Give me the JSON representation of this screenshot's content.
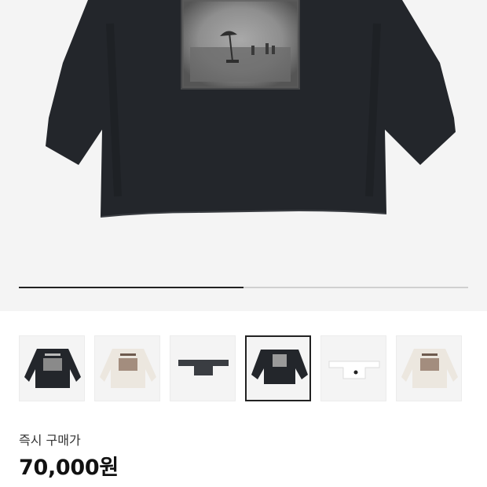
{
  "gallery": {
    "current_index": 1,
    "total": 2,
    "progress_fraction": 0.5,
    "selected_thumbnail": 3,
    "thumbnails": [
      {
        "name": "thumb-black-longsleeve-print",
        "variant": "black-print"
      },
      {
        "name": "thumb-cream-longsleeve-print",
        "variant": "cream-print"
      },
      {
        "name": "thumb-black-flat-top",
        "variant": "black-flat"
      },
      {
        "name": "thumb-black-oversized-print",
        "variant": "black-oversized"
      },
      {
        "name": "thumb-white-flat-top",
        "variant": "white-flat"
      },
      {
        "name": "thumb-cream-longsleeve-print-2",
        "variant": "cream-print"
      }
    ]
  },
  "pricing": {
    "label": "즉시 구매가",
    "price": "70,000원"
  },
  "colors": {
    "garment_dark": "#23262b",
    "garment_cream": "#ece7df",
    "background": "#f4f4f4",
    "accent": "#222222"
  }
}
